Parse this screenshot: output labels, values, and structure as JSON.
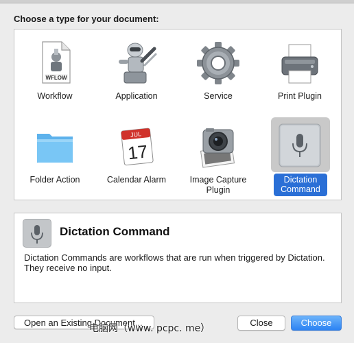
{
  "dialog": {
    "prompt": "Choose a type for your document:"
  },
  "types": [
    {
      "label": "Workflow",
      "icon": "workflow-document-icon",
      "icon_text": "WFLOW"
    },
    {
      "label": "Application",
      "icon": "automator-robot-icon"
    },
    {
      "label": "Service",
      "icon": "gear-icon"
    },
    {
      "label": "Print Plugin",
      "icon": "printer-icon"
    },
    {
      "label": "Folder Action",
      "icon": "folder-icon"
    },
    {
      "label": "Calendar Alarm",
      "icon": "calendar-icon",
      "icon_month": "JUL",
      "icon_day": "17"
    },
    {
      "label": "Image Capture Plugin",
      "icon": "camera-icon"
    },
    {
      "label": "Dictation Command",
      "icon": "microphone-icon",
      "selected": true
    }
  ],
  "selected": {
    "title": "Dictation Command",
    "description": "Dictation Commands are workflows that are run when triggered by Dictation. They receive no input."
  },
  "buttons": {
    "open_existing": "Open an Existing Document...",
    "close": "Close",
    "choose": "Choose"
  },
  "watermark": "电脑网（www. pcpc. me）",
  "colors": {
    "accent": "#2a6fd6",
    "selection_bg": "#c9c9c9"
  }
}
